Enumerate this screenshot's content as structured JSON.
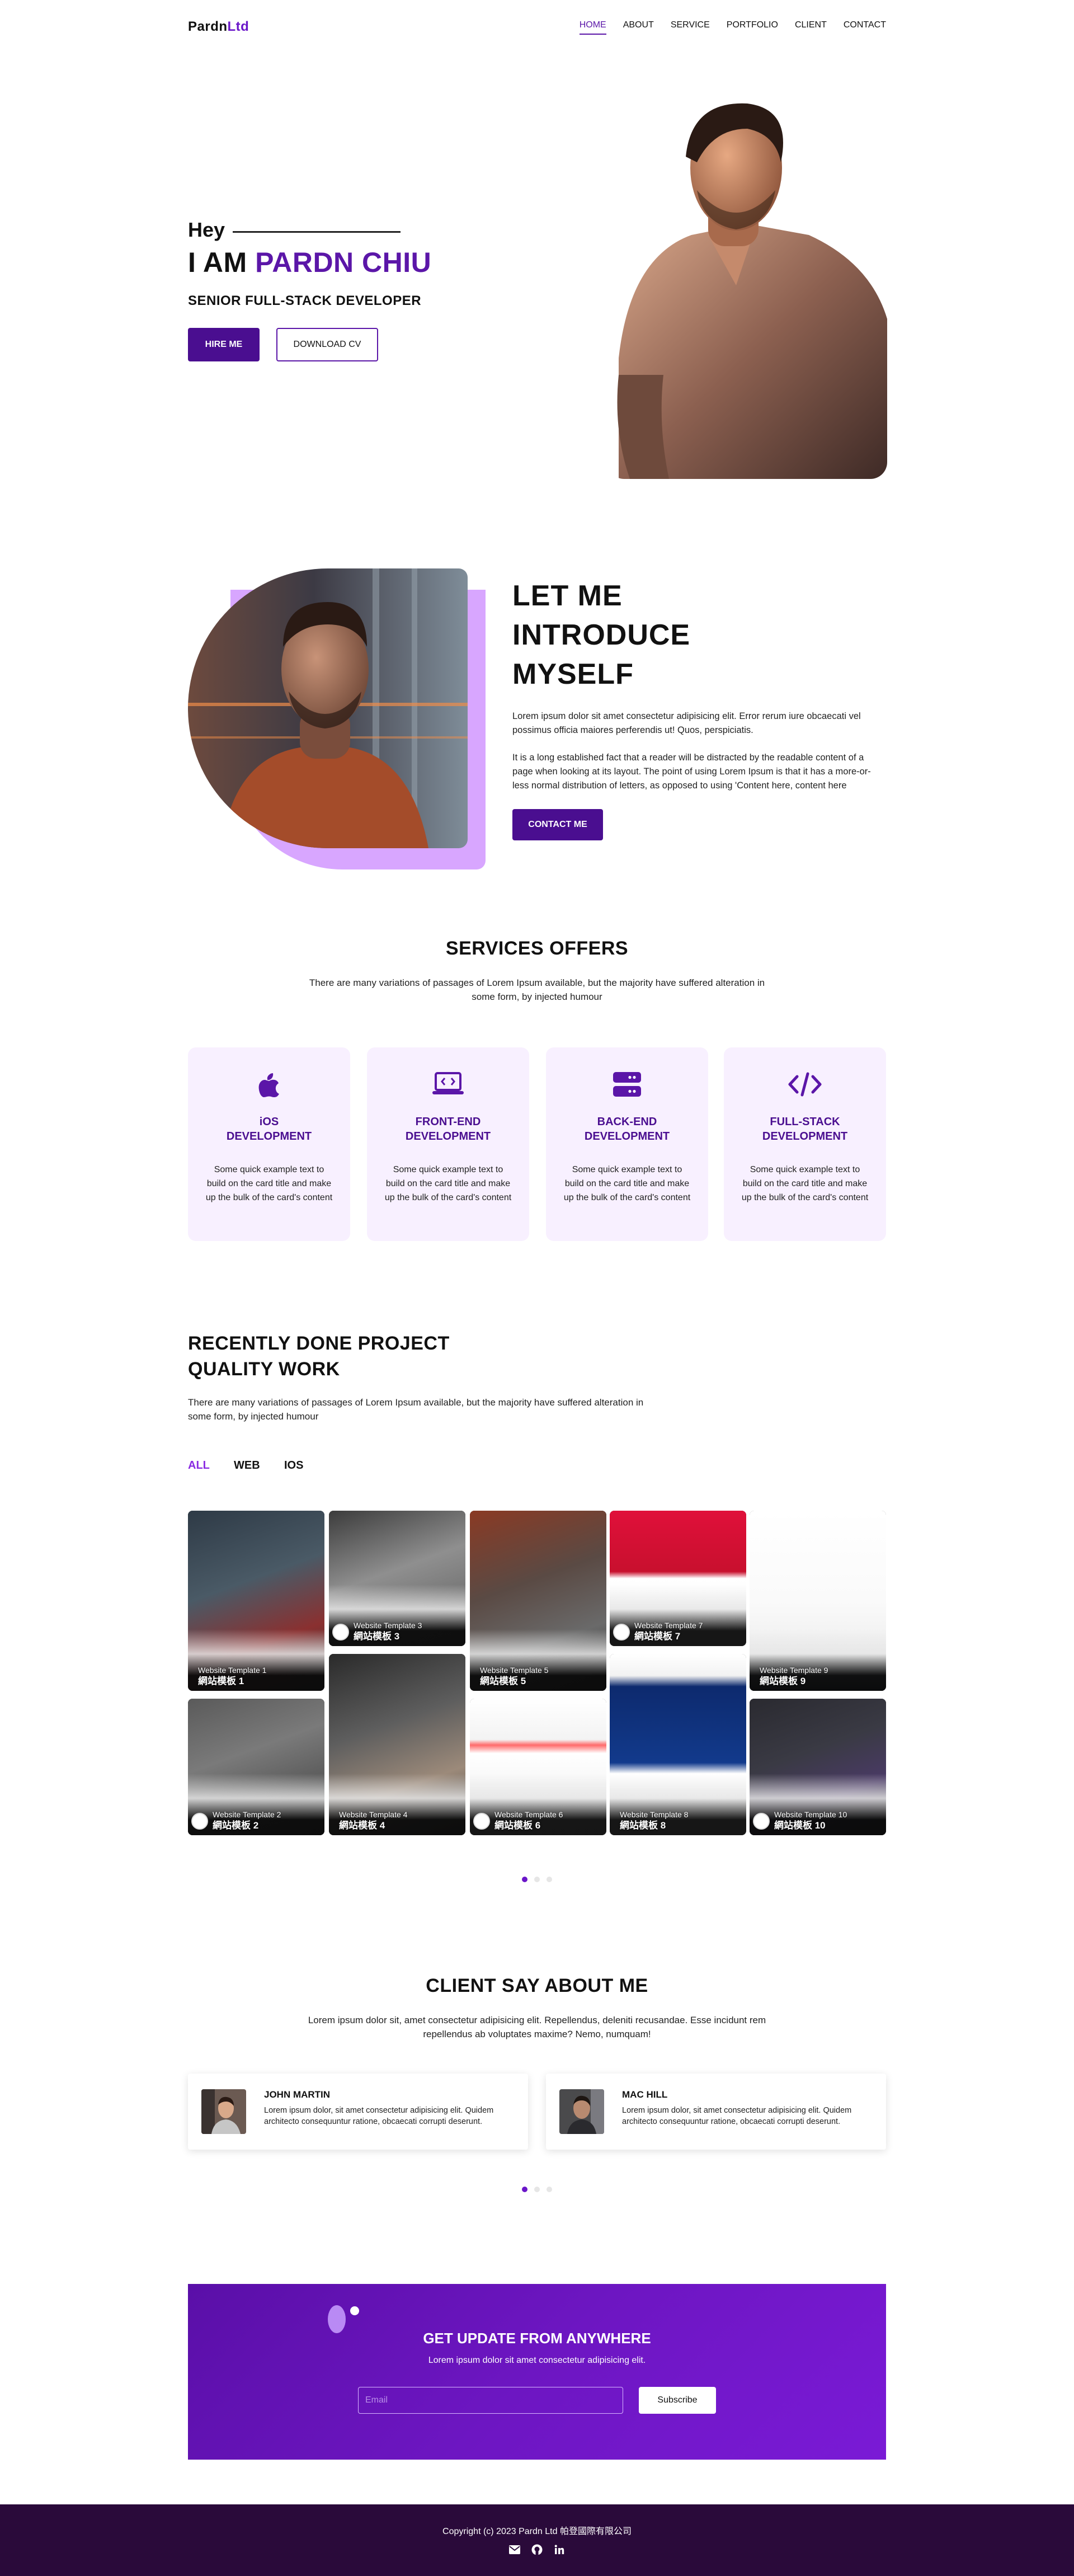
{
  "nav": {
    "logo_part1": "Pardn",
    "logo_part2": "Ltd",
    "links": [
      "HOME",
      "ABOUT",
      "SERVICE",
      "PORTFOLIO",
      "CLIENT",
      "CONTACT"
    ],
    "active_link": "HOME"
  },
  "hero": {
    "greeting": "Hey",
    "name_prefix": "I AM",
    "name": "PARDN CHIU",
    "role": "SENIOR FULL-STACK DEVELOPER",
    "hire_label": "HIRE ME",
    "cv_label": "DOWNLOAD CV"
  },
  "intro": {
    "title_lines": [
      "LET ME",
      "INTRODUCE",
      "MYSELF"
    ],
    "p1": "Lorem ipsum dolor sit amet consectetur adipisicing elit. Error rerum iure obcaecati vel possimus officia maiores perferendis ut! Quos, perspiciatis.",
    "p2": "It is a long established fact that a reader will be distracted by the readable content of a page when looking at its layout. The point of using Lorem Ipsum is that it has a more-or-less normal distribution of letters, as opposed to using 'Content here, content here",
    "contact_label": "CONTACT ME"
  },
  "services": {
    "title": "SERVICES OFFERS",
    "subtitle": "There are many variations of passages of Lorem Ipsum available, but the majority have suffered alteration in some form, by injected humour",
    "cards": [
      {
        "icon": "apple-icon",
        "title": "iOS\nDEVELOPMENT",
        "text": "Some quick example text to build on the card title and make up the bulk of the card's content"
      },
      {
        "icon": "laptop-code-icon",
        "title": "FRONT-END\nDEVELOPMENT",
        "text": "Some quick example text to build on the card title and make up the bulk of the card's content"
      },
      {
        "icon": "server-icon",
        "title": "BACK-END\nDEVELOPMENT",
        "text": "Some quick example text to build on the card title and make up the bulk of the card's content"
      },
      {
        "icon": "code-icon",
        "title": "FULL-STACK\nDEVELOPMENT",
        "text": "Some quick example text to build on the card title and make up the bulk of the card's content"
      }
    ]
  },
  "projects": {
    "title": "RECENTLY DONE PROJECT\nQUALITY WORK",
    "subtitle": "There are many variations of passages of Lorem Ipsum available, but the majority have suffered alteration in some form, by injected humour",
    "filters": [
      "ALL",
      "WEB",
      "IOS"
    ],
    "active_filter": "ALL",
    "tiles": [
      {
        "en": "Website Template 1",
        "zh": "網站模板 1"
      },
      {
        "en": "Website Template 2",
        "zh": "網站模板 2"
      },
      {
        "en": "Website Template 3",
        "zh": "網站模板 3"
      },
      {
        "en": "Website Template 4",
        "zh": "網站模板 4"
      },
      {
        "en": "Website Template 5",
        "zh": "網站模板 5"
      },
      {
        "en": "Website Template 6",
        "zh": "網站模板 6"
      },
      {
        "en": "Website Template 7",
        "zh": "網站模板 7"
      },
      {
        "en": "Website Template 8",
        "zh": "網站模板 8"
      },
      {
        "en": "Website Template 9",
        "zh": "網站模板 9"
      },
      {
        "en": "Website Template 10",
        "zh": "網站模板 10"
      }
    ],
    "active_page": 1
  },
  "clients": {
    "title": "CLIENT SAY ABOUT ME",
    "subtitle": "Lorem ipsum dolor sit, amet consectetur adipisicing elit. Repellendus, deleniti recusandae. Esse incidunt rem repellendus ab voluptates maxime? Nemo, numquam!",
    "testimonials": [
      {
        "name": "JOHN MARTIN",
        "quote": "Lorem ipsum dolor, sit amet consectetur adipisicing elit. Quidem architecto consequuntur ratione, obcaecati corrupti deserunt."
      },
      {
        "name": "MAC HILL",
        "quote": "Lorem ipsum dolor, sit amet consectetur adipisicing elit. Quidem architecto consequuntur ratione, obcaecati corrupti deserunt."
      }
    ],
    "active_page": 1
  },
  "newsletter": {
    "title": "GET UPDATE FROM ANYWHERE",
    "subtitle": "Lorem ipsum dolor sit amet consectetur adipisicing elit.",
    "email_placeholder": "Email",
    "email_value": "",
    "subscribe_label": "Subscribe"
  },
  "footer": {
    "copyright": "Copyright (c) 2023 Pardn Ltd 帕登國際有限公司",
    "icons": [
      "mail-icon",
      "github-icon",
      "linkedin-icon"
    ]
  },
  "colors": {
    "accent": "#5b16a8",
    "accent_dark": "#4a0e90",
    "card_bg": "#f8f0ff",
    "footer_bg": "#2a0a3a"
  }
}
